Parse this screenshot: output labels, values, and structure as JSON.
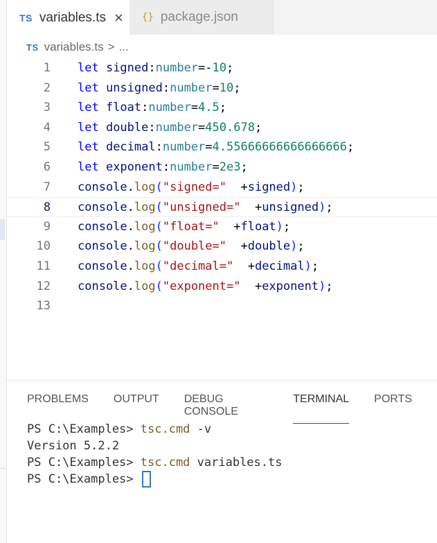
{
  "tabs": [
    {
      "icon": "TS",
      "label": "variables.ts",
      "close": "×"
    },
    {
      "icon": "{}",
      "label": "package.json"
    }
  ],
  "breadcrumb": {
    "icon": "TS",
    "file": "variables.ts",
    "separator": ">",
    "more": "..."
  },
  "editor": {
    "current_line": 8,
    "lines": [
      {
        "n": "1",
        "tokens": [
          [
            "kw",
            "let "
          ],
          [
            "id",
            "signed"
          ],
          [
            "op",
            ":"
          ],
          [
            "ty",
            "number"
          ],
          [
            "op",
            "=-"
          ],
          [
            "num",
            "10"
          ],
          [
            "op",
            ";"
          ]
        ]
      },
      {
        "n": "2",
        "tokens": [
          [
            "kw",
            "let "
          ],
          [
            "id",
            "unsigned"
          ],
          [
            "op",
            ":"
          ],
          [
            "ty",
            "number"
          ],
          [
            "op",
            "="
          ],
          [
            "num",
            "10"
          ],
          [
            "op",
            ";"
          ]
        ]
      },
      {
        "n": "3",
        "tokens": [
          [
            "kw",
            "let "
          ],
          [
            "id",
            "float"
          ],
          [
            "op",
            ":"
          ],
          [
            "ty",
            "number"
          ],
          [
            "op",
            "="
          ],
          [
            "num",
            "4.5"
          ],
          [
            "op",
            ";"
          ]
        ]
      },
      {
        "n": "4",
        "tokens": [
          [
            "kw",
            "let "
          ],
          [
            "id",
            "double"
          ],
          [
            "op",
            ":"
          ],
          [
            "ty",
            "number"
          ],
          [
            "op",
            "="
          ],
          [
            "num",
            "450.678"
          ],
          [
            "op",
            ";"
          ]
        ]
      },
      {
        "n": "5",
        "tokens": [
          [
            "kw",
            "let "
          ],
          [
            "id",
            "decimal"
          ],
          [
            "op",
            ":"
          ],
          [
            "ty",
            "number"
          ],
          [
            "op",
            "="
          ],
          [
            "num",
            "4.55666666666666666"
          ],
          [
            "op",
            ";"
          ]
        ]
      },
      {
        "n": "6",
        "tokens": [
          [
            "kw",
            "let "
          ],
          [
            "id",
            "exponent"
          ],
          [
            "op",
            ":"
          ],
          [
            "ty",
            "number"
          ],
          [
            "op",
            "="
          ],
          [
            "num",
            "2e3"
          ],
          [
            "op",
            ";"
          ]
        ]
      },
      {
        "n": "7",
        "tokens": [
          [
            "id",
            "console"
          ],
          [
            "op",
            "."
          ],
          [
            "fn",
            "log"
          ],
          [
            "pn",
            "("
          ],
          [
            "str",
            "\"signed=\""
          ],
          [
            "op",
            "  +"
          ],
          [
            "id",
            "signed"
          ],
          [
            "pn",
            ")"
          ],
          [
            "op",
            ";"
          ]
        ]
      },
      {
        "n": "8",
        "tokens": [
          [
            "id",
            "console"
          ],
          [
            "op",
            "."
          ],
          [
            "fn",
            "log"
          ],
          [
            "pn",
            "("
          ],
          [
            "str",
            "\"unsigned=\""
          ],
          [
            "op",
            "  +"
          ],
          [
            "id",
            "unsigned"
          ],
          [
            "pn",
            ")"
          ],
          [
            "op",
            ";"
          ]
        ]
      },
      {
        "n": "9",
        "tokens": [
          [
            "id",
            "console"
          ],
          [
            "op",
            "."
          ],
          [
            "fn",
            "log"
          ],
          [
            "pn",
            "("
          ],
          [
            "str",
            "\"float=\""
          ],
          [
            "op",
            "  +"
          ],
          [
            "id",
            "float"
          ],
          [
            "pn",
            ")"
          ],
          [
            "op",
            ";"
          ]
        ]
      },
      {
        "n": "10",
        "tokens": [
          [
            "id",
            "console"
          ],
          [
            "op",
            "."
          ],
          [
            "fn",
            "log"
          ],
          [
            "pn",
            "("
          ],
          [
            "str",
            "\"double=\""
          ],
          [
            "op",
            "  +"
          ],
          [
            "id",
            "double"
          ],
          [
            "pn",
            ")"
          ],
          [
            "op",
            ";"
          ]
        ]
      },
      {
        "n": "11",
        "tokens": [
          [
            "id",
            "console"
          ],
          [
            "op",
            "."
          ],
          [
            "fn",
            "log"
          ],
          [
            "pn",
            "("
          ],
          [
            "str",
            "\"decimal=\""
          ],
          [
            "op",
            "  +"
          ],
          [
            "id",
            "decimal"
          ],
          [
            "pn",
            ")"
          ],
          [
            "op",
            ";"
          ]
        ]
      },
      {
        "n": "12",
        "tokens": [
          [
            "id",
            "console"
          ],
          [
            "op",
            "."
          ],
          [
            "fn",
            "log"
          ],
          [
            "pn",
            "("
          ],
          [
            "str",
            "\"exponent=\""
          ],
          [
            "op",
            "  +"
          ],
          [
            "id",
            "exponent"
          ],
          [
            "pn",
            ")"
          ],
          [
            "op",
            ";"
          ]
        ]
      },
      {
        "n": "13",
        "tokens": []
      }
    ]
  },
  "panel": {
    "tabs": [
      "PROBLEMS",
      "OUTPUT",
      "DEBUG CONSOLE",
      "TERMINAL",
      "PORTS"
    ],
    "active_tab": "TERMINAL",
    "terminal": [
      {
        "prompt": "PS C:\\Examples> ",
        "cmd": "tsc.cmd",
        "args": " -v"
      },
      {
        "output": "Version 5.2.2"
      },
      {
        "prompt": "PS C:\\Examples> ",
        "cmd": "tsc.cmd",
        "args": " variables.ts"
      },
      {
        "prompt": "PS C:\\Examples> ",
        "cursor": true
      }
    ]
  },
  "colors": {
    "accent": "#005fb8",
    "ts_blue": "#3178c6"
  }
}
